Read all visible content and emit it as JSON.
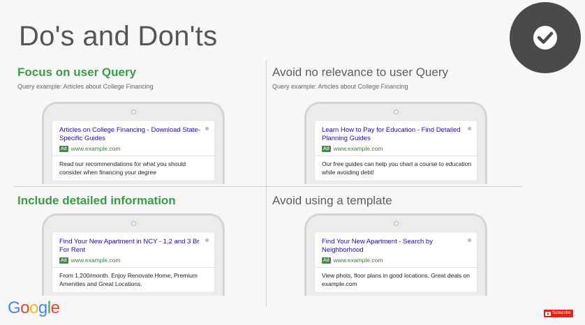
{
  "slide": {
    "title": "Do's and Don'ts"
  },
  "brand": {
    "logo_letters": [
      "G",
      "o",
      "o",
      "g",
      "l",
      "e"
    ],
    "logo_colors": [
      "#4285F4",
      "#EA4335",
      "#FBBC05",
      "#4285F4",
      "#34A853",
      "#EA4335"
    ],
    "subscribe_label": "Subscribe"
  },
  "colors": {
    "do_heading": "#3c9a4a",
    "dont_heading": "#5e5e5e",
    "ad_title": "#1a0dab",
    "ad_url": "#3d7a3d",
    "badge": "#4a4a4a"
  },
  "quadrants": {
    "top_left": {
      "heading": "Focus on user Query",
      "query": "Query example: Articles about College Financing",
      "ad": {
        "title": "Articles on College Financing - Download State-Specific Guides",
        "badge": "Ad",
        "url": "www.example.com",
        "description": "Read our recommendations for what you should consider when financing your degree"
      }
    },
    "top_right": {
      "heading": "Avoid no relevance to user Query",
      "query": "Query example: Articles about College Financing",
      "ad": {
        "title": "Learn How to Pay for Education - Find Detailed Planning Guides",
        "badge": "Ad",
        "url": "www.example.com",
        "description": "Our free guides can help you chart a course to education while avoiding debt!"
      }
    },
    "bottom_left": {
      "heading": "Include detailed information",
      "ad": {
        "title": "Find Your New Apartment in NCY - 1,2 and 3 Br For Rent",
        "badge": "Ad",
        "url": "www.example.com",
        "description": "From 1.200/month. Enjoy Renovate Home, Premium Amenities and Great Locations."
      }
    },
    "bottom_right": {
      "heading": "Avoid using a template",
      "ad": {
        "title": "Find Your New Apartment - Search by Neighborhood",
        "badge": "Ad",
        "url": "www.example.com",
        "description": "View phots, floor plans in good locations. Great deals on example.com"
      }
    }
  }
}
